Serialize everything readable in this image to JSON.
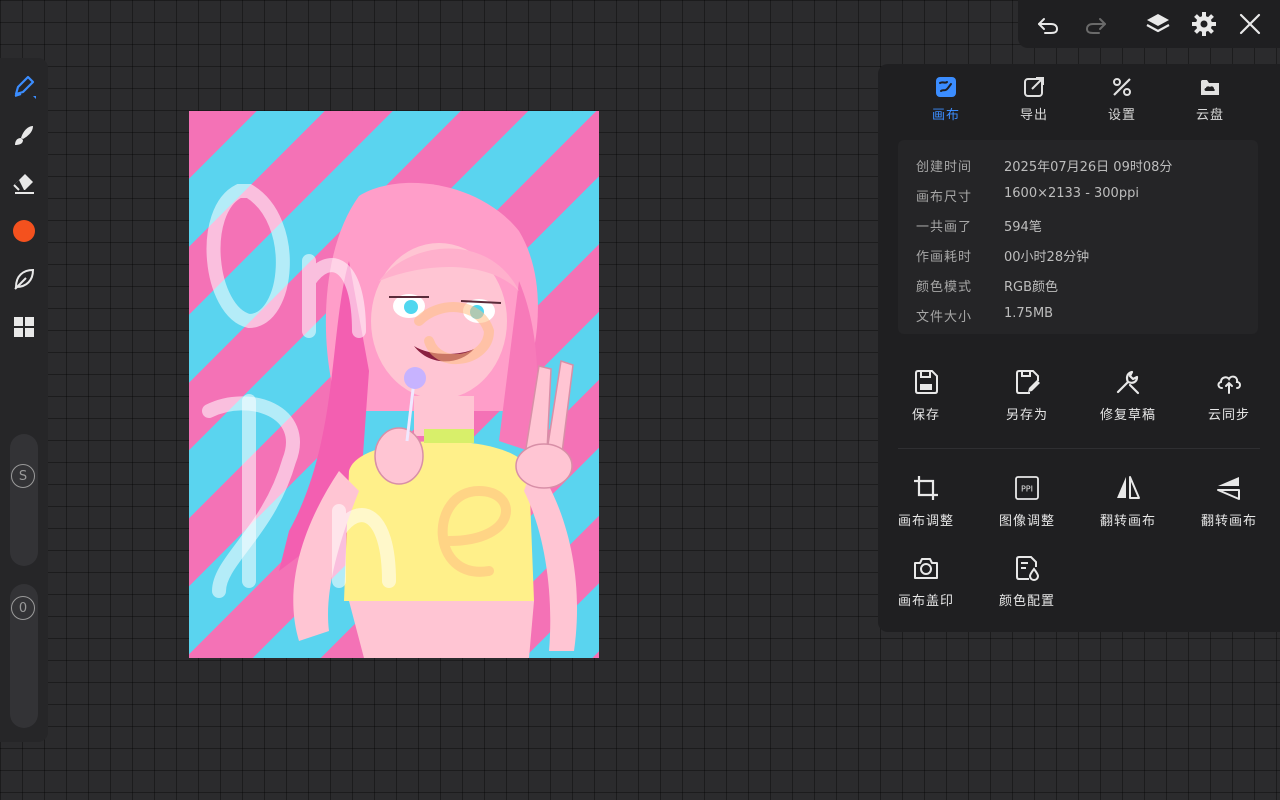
{
  "colors": {
    "accent": "#3b8dff",
    "brush_color": "#f4511e",
    "stripe_pink": "#f472b6",
    "stripe_cyan": "#5ad4ef"
  },
  "left_toolbar": {
    "tools": [
      {
        "name": "pen",
        "icon": "pen-icon",
        "active": true
      },
      {
        "name": "brush",
        "icon": "brush-icon"
      },
      {
        "name": "eraser",
        "icon": "eraser-icon"
      },
      {
        "name": "color",
        "icon": "color-swatch"
      },
      {
        "name": "smudge",
        "icon": "leaf-icon"
      },
      {
        "name": "more",
        "icon": "grid-icon"
      }
    ],
    "size_slider_label": "S",
    "opacity_slider_label": "0"
  },
  "top_toolbar": {
    "buttons": [
      "undo-icon",
      "redo-icon",
      "layers-icon",
      "gear-icon",
      "close-icon"
    ]
  },
  "panel": {
    "tabs": [
      {
        "label": "画布",
        "icon": "canvas-icon",
        "active": true
      },
      {
        "label": "导出",
        "icon": "export-icon"
      },
      {
        "label": "设置",
        "icon": "tools-icon"
      },
      {
        "label": "云盘",
        "icon": "cloud-folder-icon"
      }
    ],
    "info": [
      {
        "key": "创建时间",
        "value": "2025年07月26日 09时08分"
      },
      {
        "key": "画布尺寸",
        "value": "1600×2133 - 300ppi"
      },
      {
        "key": "一共画了",
        "value": "594笔"
      },
      {
        "key": "作画耗时",
        "value": "00小时28分钟"
      },
      {
        "key": "颜色模式",
        "value": "RGB颜色"
      },
      {
        "key": "文件大小",
        "value": "1.75MB"
      }
    ],
    "actions_row1": [
      {
        "label": "保存",
        "icon": "save-icon"
      },
      {
        "label": "另存为",
        "icon": "save-as-icon"
      },
      {
        "label": "修复草稿",
        "icon": "wrench-icon"
      },
      {
        "label": "云同步",
        "icon": "cloud-sync-icon"
      }
    ],
    "actions_row2": [
      {
        "label": "画布调整",
        "icon": "crop-icon"
      },
      {
        "label": "图像调整",
        "icon": "ppi-icon",
        "icon_text": "PPI"
      },
      {
        "label": "翻转画布",
        "icon": "flip-horizontal-icon"
      },
      {
        "label": "翻转画布",
        "icon": "flip-vertical-icon"
      }
    ],
    "actions_row3": [
      {
        "label": "画布盖印",
        "icon": "camera-icon"
      },
      {
        "label": "颜色配置",
        "icon": "color-config-icon"
      }
    ]
  }
}
